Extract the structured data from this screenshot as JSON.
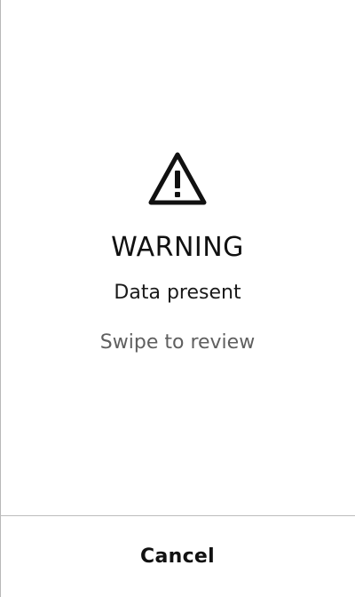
{
  "dialog": {
    "icon": "warning-triangle-icon",
    "title": "WARNING",
    "message": "Data present",
    "hint": "Swipe to review",
    "cancel_label": "Cancel"
  },
  "colors": {
    "background": "#ffffff",
    "text_primary": "#111111",
    "text_secondary": "#5f5f5f",
    "divider": "#bdbdbd"
  }
}
